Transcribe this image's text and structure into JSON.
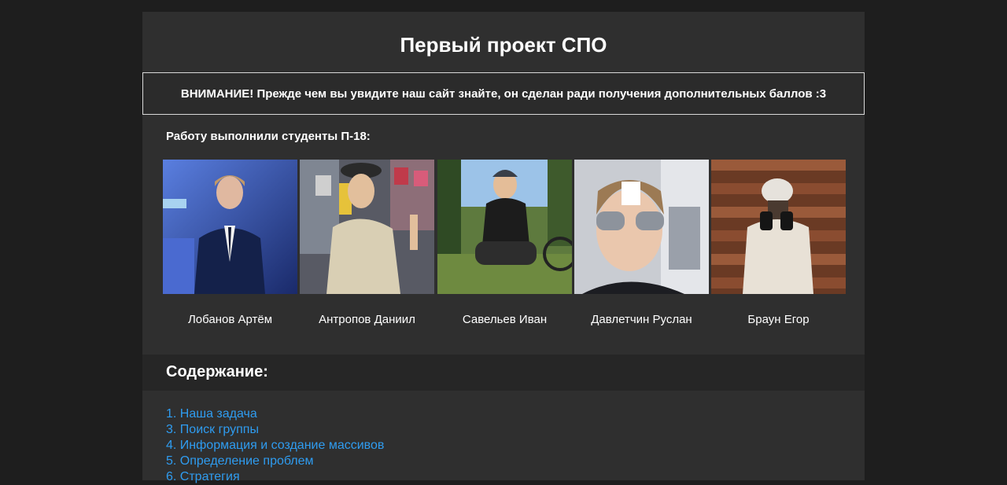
{
  "header": {
    "title": "Первый проект СПО"
  },
  "notice": {
    "text": "ВНИМАНИЕ! Прежде чем вы увидите наш сайт знайте, он сделан ради получения дополнительных баллов :3"
  },
  "students": {
    "heading": "Работу выполнили студенты П-18:",
    "items": [
      {
        "name": "Лобанов Артём"
      },
      {
        "name": "Антропов Даниил"
      },
      {
        "name": "Савельев Иван"
      },
      {
        "name": "Давлетчин Руслан"
      },
      {
        "name": "Браун Егор"
      }
    ]
  },
  "contents": {
    "title": "Содержание:",
    "items": [
      {
        "label": "1. Наша задача"
      },
      {
        "label": "3. Поиск группы"
      },
      {
        "label": "4. Информация и создание массивов"
      },
      {
        "label": "5. Определение проблем"
      },
      {
        "label": "6. Стратегия"
      }
    ]
  },
  "colors": {
    "background": "#1e1e1e",
    "panel": "#2f2f2f",
    "link": "#2f9cf0"
  }
}
